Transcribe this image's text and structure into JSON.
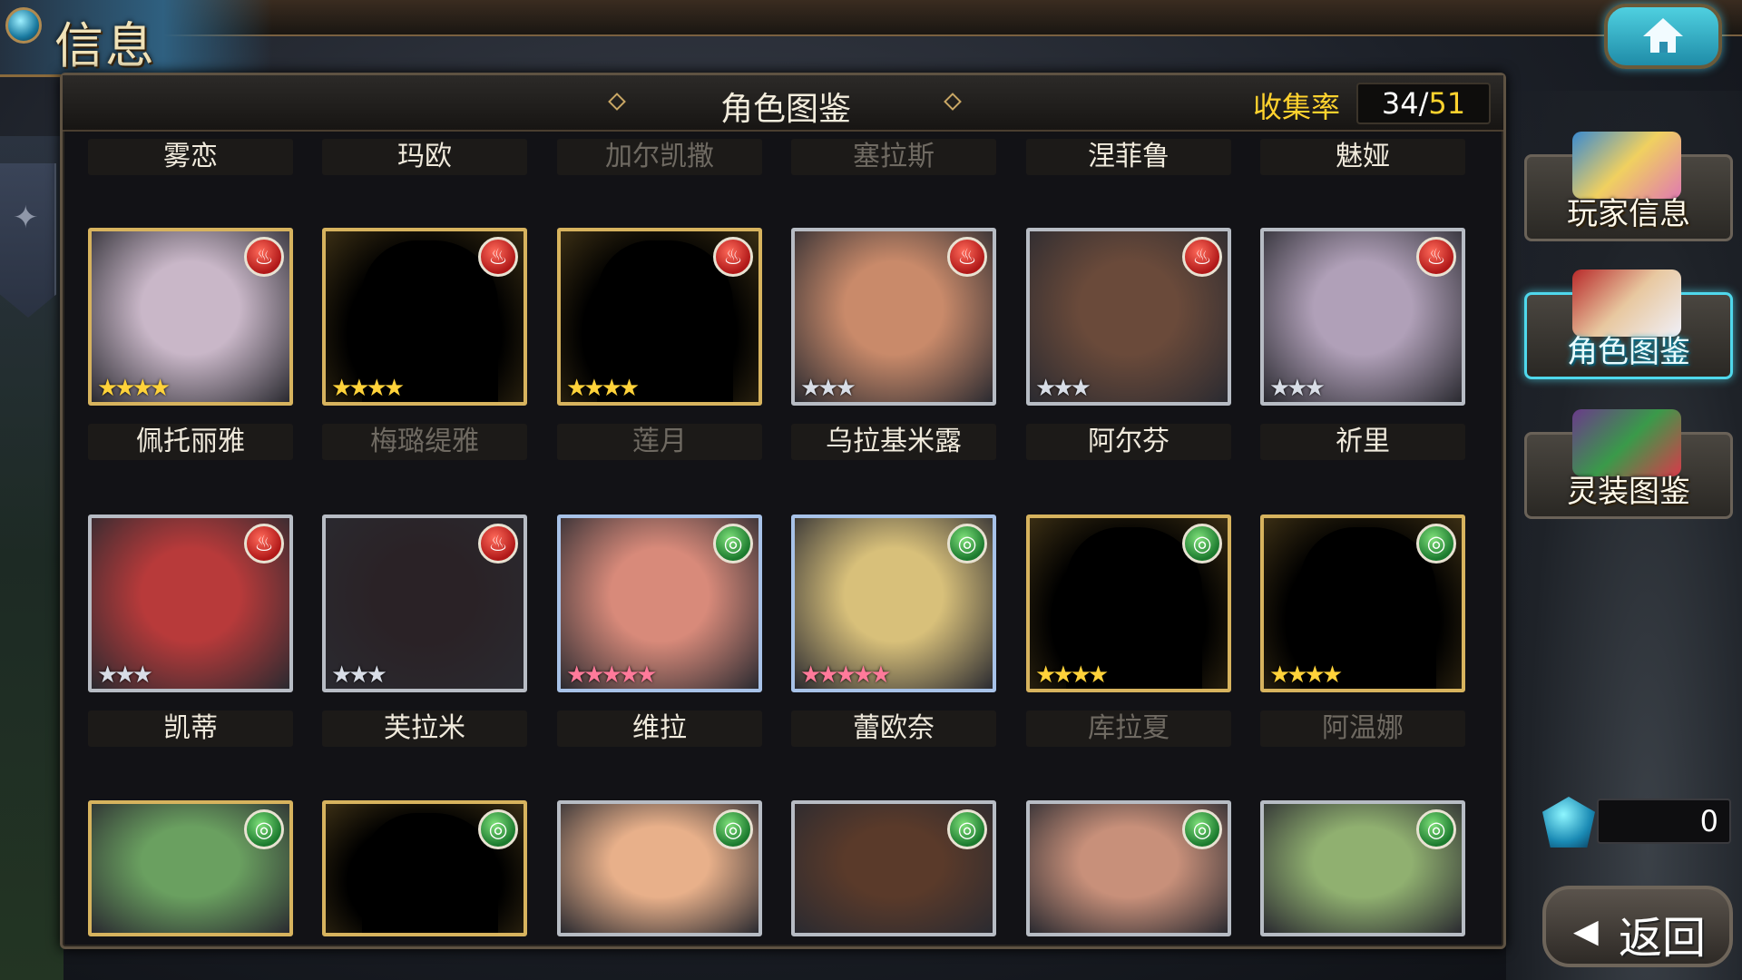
{
  "header": {
    "title": "信息"
  },
  "panel": {
    "title": "角色图鉴",
    "collection_label": "收集率",
    "collection_owned": "34",
    "collection_separator": "/",
    "collection_total": "51"
  },
  "top_names": [
    {
      "name": "雾恋",
      "dim": false
    },
    {
      "name": "玛欧",
      "dim": false
    },
    {
      "name": "加尔凯撒",
      "dim": true
    },
    {
      "name": "塞拉斯",
      "dim": true
    },
    {
      "name": "涅菲鲁",
      "dim": false
    },
    {
      "name": "魅娅",
      "dim": false
    }
  ],
  "rows": [
    {
      "cards": [
        {
          "name": "佩托丽雅",
          "frame": "gold",
          "element": "fire",
          "stars": 4,
          "star_color": "gold",
          "locked": false,
          "name_dim": false,
          "tint": "#c9b7c8"
        },
        {
          "name": "梅璐缇雅",
          "frame": "gold",
          "element": "fire",
          "stars": 4,
          "star_color": "gold",
          "locked": true,
          "name_dim": true,
          "tint": "#000000"
        },
        {
          "name": "莲月",
          "frame": "gold",
          "element": "fire",
          "stars": 4,
          "star_color": "gold",
          "locked": true,
          "name_dim": true,
          "tint": "#000000"
        },
        {
          "name": "乌拉基米露",
          "frame": "silver",
          "element": "fire",
          "stars": 3,
          "star_color": "silver",
          "locked": false,
          "name_dim": false,
          "tint": "#c98a6a"
        },
        {
          "name": "阿尔芬",
          "frame": "silver",
          "element": "fire",
          "stars": 3,
          "star_color": "silver",
          "locked": false,
          "name_dim": false,
          "tint": "#6a4a3a"
        },
        {
          "name": "祈里",
          "frame": "silver",
          "element": "fire",
          "stars": 3,
          "star_color": "silver",
          "locked": false,
          "name_dim": false,
          "tint": "#b0a0b8"
        }
      ]
    },
    {
      "cards": [
        {
          "name": "凯蒂",
          "frame": "silver",
          "element": "fire",
          "stars": 3,
          "star_color": "silver",
          "locked": false,
          "name_dim": false,
          "tint": "#b83a3a"
        },
        {
          "name": "芙拉米",
          "frame": "silver",
          "element": "fire",
          "stars": 3,
          "star_color": "silver",
          "locked": false,
          "name_dim": false,
          "tint": "#2a2226"
        },
        {
          "name": "维拉",
          "frame": "rainbow",
          "element": "wind",
          "stars": 5,
          "star_color": "rainbow",
          "locked": false,
          "name_dim": false,
          "tint": "#d88a7a"
        },
        {
          "name": "蕾欧奈",
          "frame": "rainbow",
          "element": "wind",
          "stars": 5,
          "star_color": "rainbow",
          "locked": false,
          "name_dim": false,
          "tint": "#d8c07a"
        },
        {
          "name": "库拉夏",
          "frame": "gold",
          "element": "wind",
          "stars": 4,
          "star_color": "gold",
          "locked": true,
          "name_dim": true,
          "tint": "#000000"
        },
        {
          "name": "阿温娜",
          "frame": "gold",
          "element": "wind",
          "stars": 4,
          "star_color": "gold",
          "locked": true,
          "name_dim": true,
          "tint": "#000000"
        }
      ]
    },
    {
      "cards": [
        {
          "frame": "gold",
          "element": "wind",
          "locked": false,
          "tint": "#6aa060"
        },
        {
          "frame": "gold",
          "element": "wind",
          "locked": true,
          "tint": "#000000"
        },
        {
          "frame": "silver",
          "element": "wind",
          "locked": false,
          "tint": "#e8b08a"
        },
        {
          "frame": "silver",
          "element": "wind",
          "locked": false,
          "tint": "#5a3a2a"
        },
        {
          "frame": "silver",
          "element": "wind",
          "locked": false,
          "tint": "#c8907a"
        },
        {
          "frame": "silver",
          "element": "wind",
          "locked": false,
          "tint": "#90b070"
        }
      ]
    }
  ],
  "sidebar": {
    "player_info": "玩家信息",
    "character_codex": "角色图鉴",
    "equipment_codex": "灵装图鉴"
  },
  "currency": {
    "value": "0"
  },
  "back_label": "返回",
  "icons": {
    "fire": "fire-element-icon",
    "wind": "wind-element-icon",
    "home": "home-icon",
    "back": "back-arrow-icon",
    "gem": "gem-icon"
  }
}
